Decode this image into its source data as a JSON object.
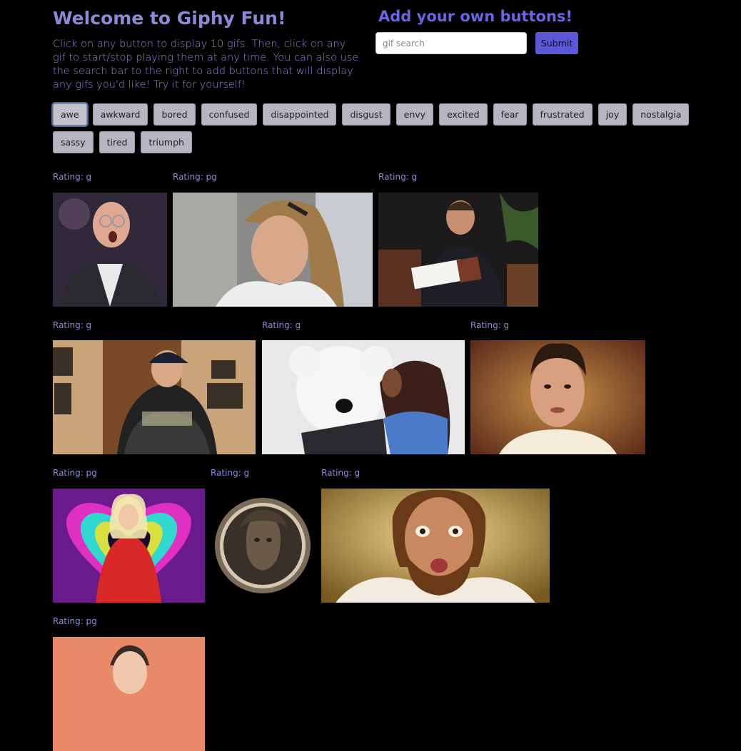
{
  "header": {
    "title": "Welcome to Giphy Fun!",
    "intro": "Click on any button to display 10 gifs. Then, click on any gif to start/stop playing them at any time. You can also use the search bar to the right to add buttons that will display any gifs you'd like! Try it for yourself!"
  },
  "add_section": {
    "title": "Add your own buttons!",
    "placeholder": "gif search",
    "submit_label": "Submit"
  },
  "buttons": [
    {
      "label": "awe",
      "active": true
    },
    {
      "label": "awkward"
    },
    {
      "label": "bored"
    },
    {
      "label": "confused"
    },
    {
      "label": "disappointed"
    },
    {
      "label": "disgust"
    },
    {
      "label": "envy"
    },
    {
      "label": "excited"
    },
    {
      "label": "fear"
    },
    {
      "label": "frustrated"
    },
    {
      "label": "joy"
    },
    {
      "label": "nostalgia"
    },
    {
      "label": "sassy"
    },
    {
      "label": "tired"
    },
    {
      "label": "triumph"
    }
  ],
  "gifs": [
    {
      "rating": "Rating: g",
      "subject": "bald man with glasses looking shocked"
    },
    {
      "rating": "Rating: pg",
      "subject": "woman with ponytail looking down"
    },
    {
      "rating": "Rating: g",
      "subject": "man in suit reading a book"
    },
    {
      "rating": "Rating: g",
      "subject": "man in swag sweatshirt and backwards cap"
    },
    {
      "rating": "Rating: g",
      "subject": "giant white teddy bear with woman"
    },
    {
      "rating": "Rating: g",
      "subject": "man with dark hair looking shocked"
    },
    {
      "rating": "Rating: pg",
      "subject": "blonde woman in red on neon heart background"
    },
    {
      "rating": "Rating: g",
      "subject": "round bronze medallion with face"
    },
    {
      "rating": "Rating: g",
      "subject": "bearded man with wide eyes"
    },
    {
      "rating": "Rating: pg",
      "subject": "person on orange background"
    }
  ]
}
